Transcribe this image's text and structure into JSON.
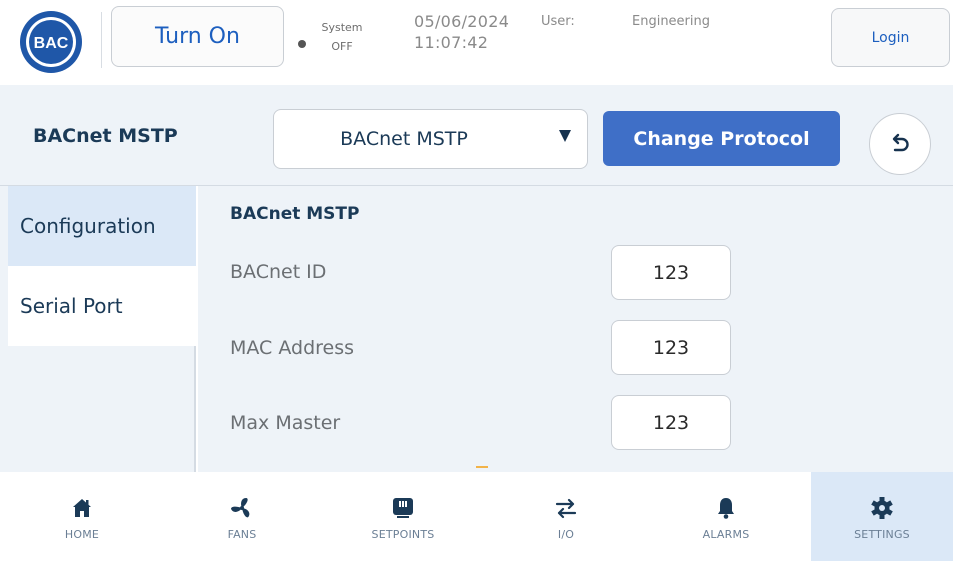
{
  "header": {
    "logo_text": "BAC",
    "turn_on_label": "Turn On",
    "system_label": "System",
    "system_state": "OFF",
    "date": "05/06/2024",
    "time": "11:07:42",
    "user_label": "User:",
    "user_value": "Engineering",
    "login_label": "Login"
  },
  "protocol_bar": {
    "title": "BACnet MSTP",
    "selected_protocol": "BACnet MSTP",
    "change_button": "Change Protocol"
  },
  "side_nav": {
    "items": [
      {
        "label": "Configuration",
        "active": true
      },
      {
        "label": "Serial Port",
        "active": false
      }
    ]
  },
  "content": {
    "section_title": "BACnet MSTP",
    "fields": [
      {
        "label": "BACnet ID",
        "value": "123"
      },
      {
        "label": "MAC Address",
        "value": "123"
      },
      {
        "label": "Max Master",
        "value": "123"
      }
    ]
  },
  "bottom_nav": {
    "items": [
      {
        "label": "HOME",
        "icon": "home-icon"
      },
      {
        "label": "FANS",
        "icon": "fan-icon"
      },
      {
        "label": "SETPOINTS",
        "icon": "setpoints-icon"
      },
      {
        "label": "I/O",
        "icon": "io-arrows-icon"
      },
      {
        "label": "ALARMS",
        "icon": "bell-icon"
      },
      {
        "label": "SETTINGS",
        "icon": "gear-icon",
        "active": true
      }
    ]
  },
  "colors": {
    "brand_blue": "#1d5fbf",
    "primary_button": "#3f6fc7",
    "panel_bg": "#eef3f8",
    "active_bg": "#dbe8f7",
    "nav_icon": "#1b3a57"
  }
}
